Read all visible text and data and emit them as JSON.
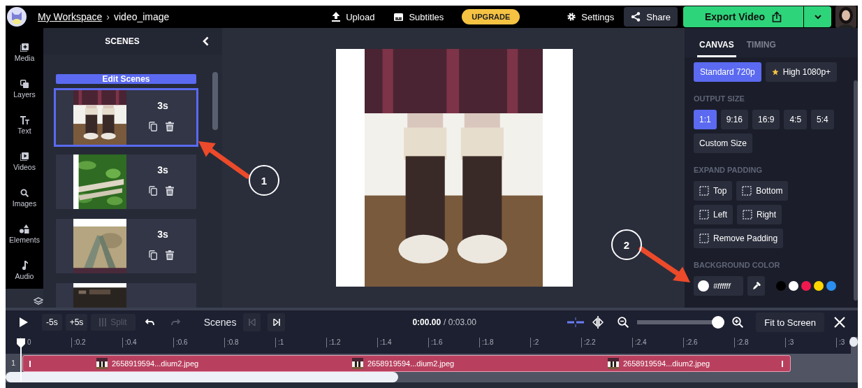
{
  "top_bar": {
    "workspace": "My Workspace",
    "separator": "›",
    "project": "video_image",
    "actions": [
      {
        "kind": "upload",
        "label": "Upload"
      },
      {
        "kind": "subtitles",
        "label": "Subtitles"
      },
      {
        "kind": "upgrade",
        "label": "UPGRADE"
      },
      {
        "kind": "settings",
        "label": "Settings"
      },
      {
        "kind": "share",
        "label": "Share"
      }
    ],
    "export": "Export Video"
  },
  "sidebar": {
    "items": [
      {
        "kind": "media",
        "label": "Media"
      },
      {
        "kind": "layers",
        "label": "Layers"
      },
      {
        "kind": "text",
        "label": "Text"
      },
      {
        "kind": "videos",
        "label": "Videos"
      },
      {
        "kind": "images",
        "label": "Images"
      },
      {
        "kind": "elements",
        "label": "Elements"
      },
      {
        "kind": "audio",
        "label": "Audio"
      },
      {
        "kind": "more"
      }
    ]
  },
  "scenes": {
    "title": "SCENES",
    "edit_button": "Edit Scenes",
    "items": [
      {
        "duration": "3s",
        "selected": true
      },
      {
        "duration": "3s",
        "selected": false
      },
      {
        "duration": "3s",
        "selected": false
      },
      {
        "selected": false
      }
    ]
  },
  "properties": {
    "tabs": [
      {
        "label": "CANVAS",
        "selected": true
      },
      {
        "label": "TIMING",
        "selected": false
      }
    ],
    "quality": [
      {
        "label": "Standard 720p",
        "selected": true,
        "premium": false
      },
      {
        "label": "High 1080p+",
        "selected": false,
        "premium": true
      }
    ],
    "output_size": {
      "title": "OUTPUT SIZE",
      "options": [
        {
          "label": "1:1",
          "selected": true
        },
        {
          "label": "9:16",
          "selected": false
        },
        {
          "label": "16:9",
          "selected": false
        },
        {
          "label": "4:5",
          "selected": false
        },
        {
          "label": "5:4",
          "selected": false
        }
      ],
      "custom": "Custom Size"
    },
    "expand_padding": {
      "title": "EXPAND PADDING",
      "options": [
        "Top",
        "Bottom",
        "Left",
        "Right",
        "Remove Padding"
      ]
    },
    "background_color": {
      "title": "BACKGROUND COLOR",
      "value": "#ffffff",
      "swatches": [
        {
          "color": "#000000"
        },
        {
          "color": "#ffffff"
        },
        {
          "color": "#f0194f"
        },
        {
          "color": "#ffd600"
        },
        {
          "color": "#2b8ff0"
        }
      ]
    }
  },
  "timeline": {
    "controls": [
      {
        "kind": "play"
      },
      {
        "kind": "button",
        "label": "-5s"
      },
      {
        "kind": "button",
        "label": "+5s"
      },
      {
        "kind": "split",
        "label": "Split",
        "disabled": true
      },
      {
        "kind": "undo",
        "disabled": false
      },
      {
        "kind": "redo",
        "disabled": true
      }
    ],
    "scenes_label": "Scenes",
    "scene_nav": [
      {
        "kind": "prev",
        "disabled": true
      },
      {
        "kind": "next",
        "disabled": false
      }
    ],
    "current_time": "0:00.00",
    "total_time": "/ 0:03.00",
    "zoom": {
      "level": 0.93
    },
    "fit_button": "Fit to Screen",
    "ruler": [
      "0",
      ":0.2",
      ":0.4",
      ":0.6",
      ":0.8",
      ":1",
      ":1.2",
      ":1.4",
      ":1.6",
      ":1.8",
      ":2",
      ":2.2",
      ":2.4",
      ":2.6",
      ":2.8",
      ":3",
      ":3"
    ],
    "tracks": [
      {
        "number": "1",
        "clips": [
          {
            "name": "2658919594...dium2.jpeg"
          },
          {
            "name": "2658919594...dium2.jpeg"
          },
          {
            "name": "2658919594...dium2.jpeg"
          }
        ]
      }
    ]
  },
  "annotations": [
    {
      "label": "1"
    },
    {
      "label": "2"
    }
  ]
}
